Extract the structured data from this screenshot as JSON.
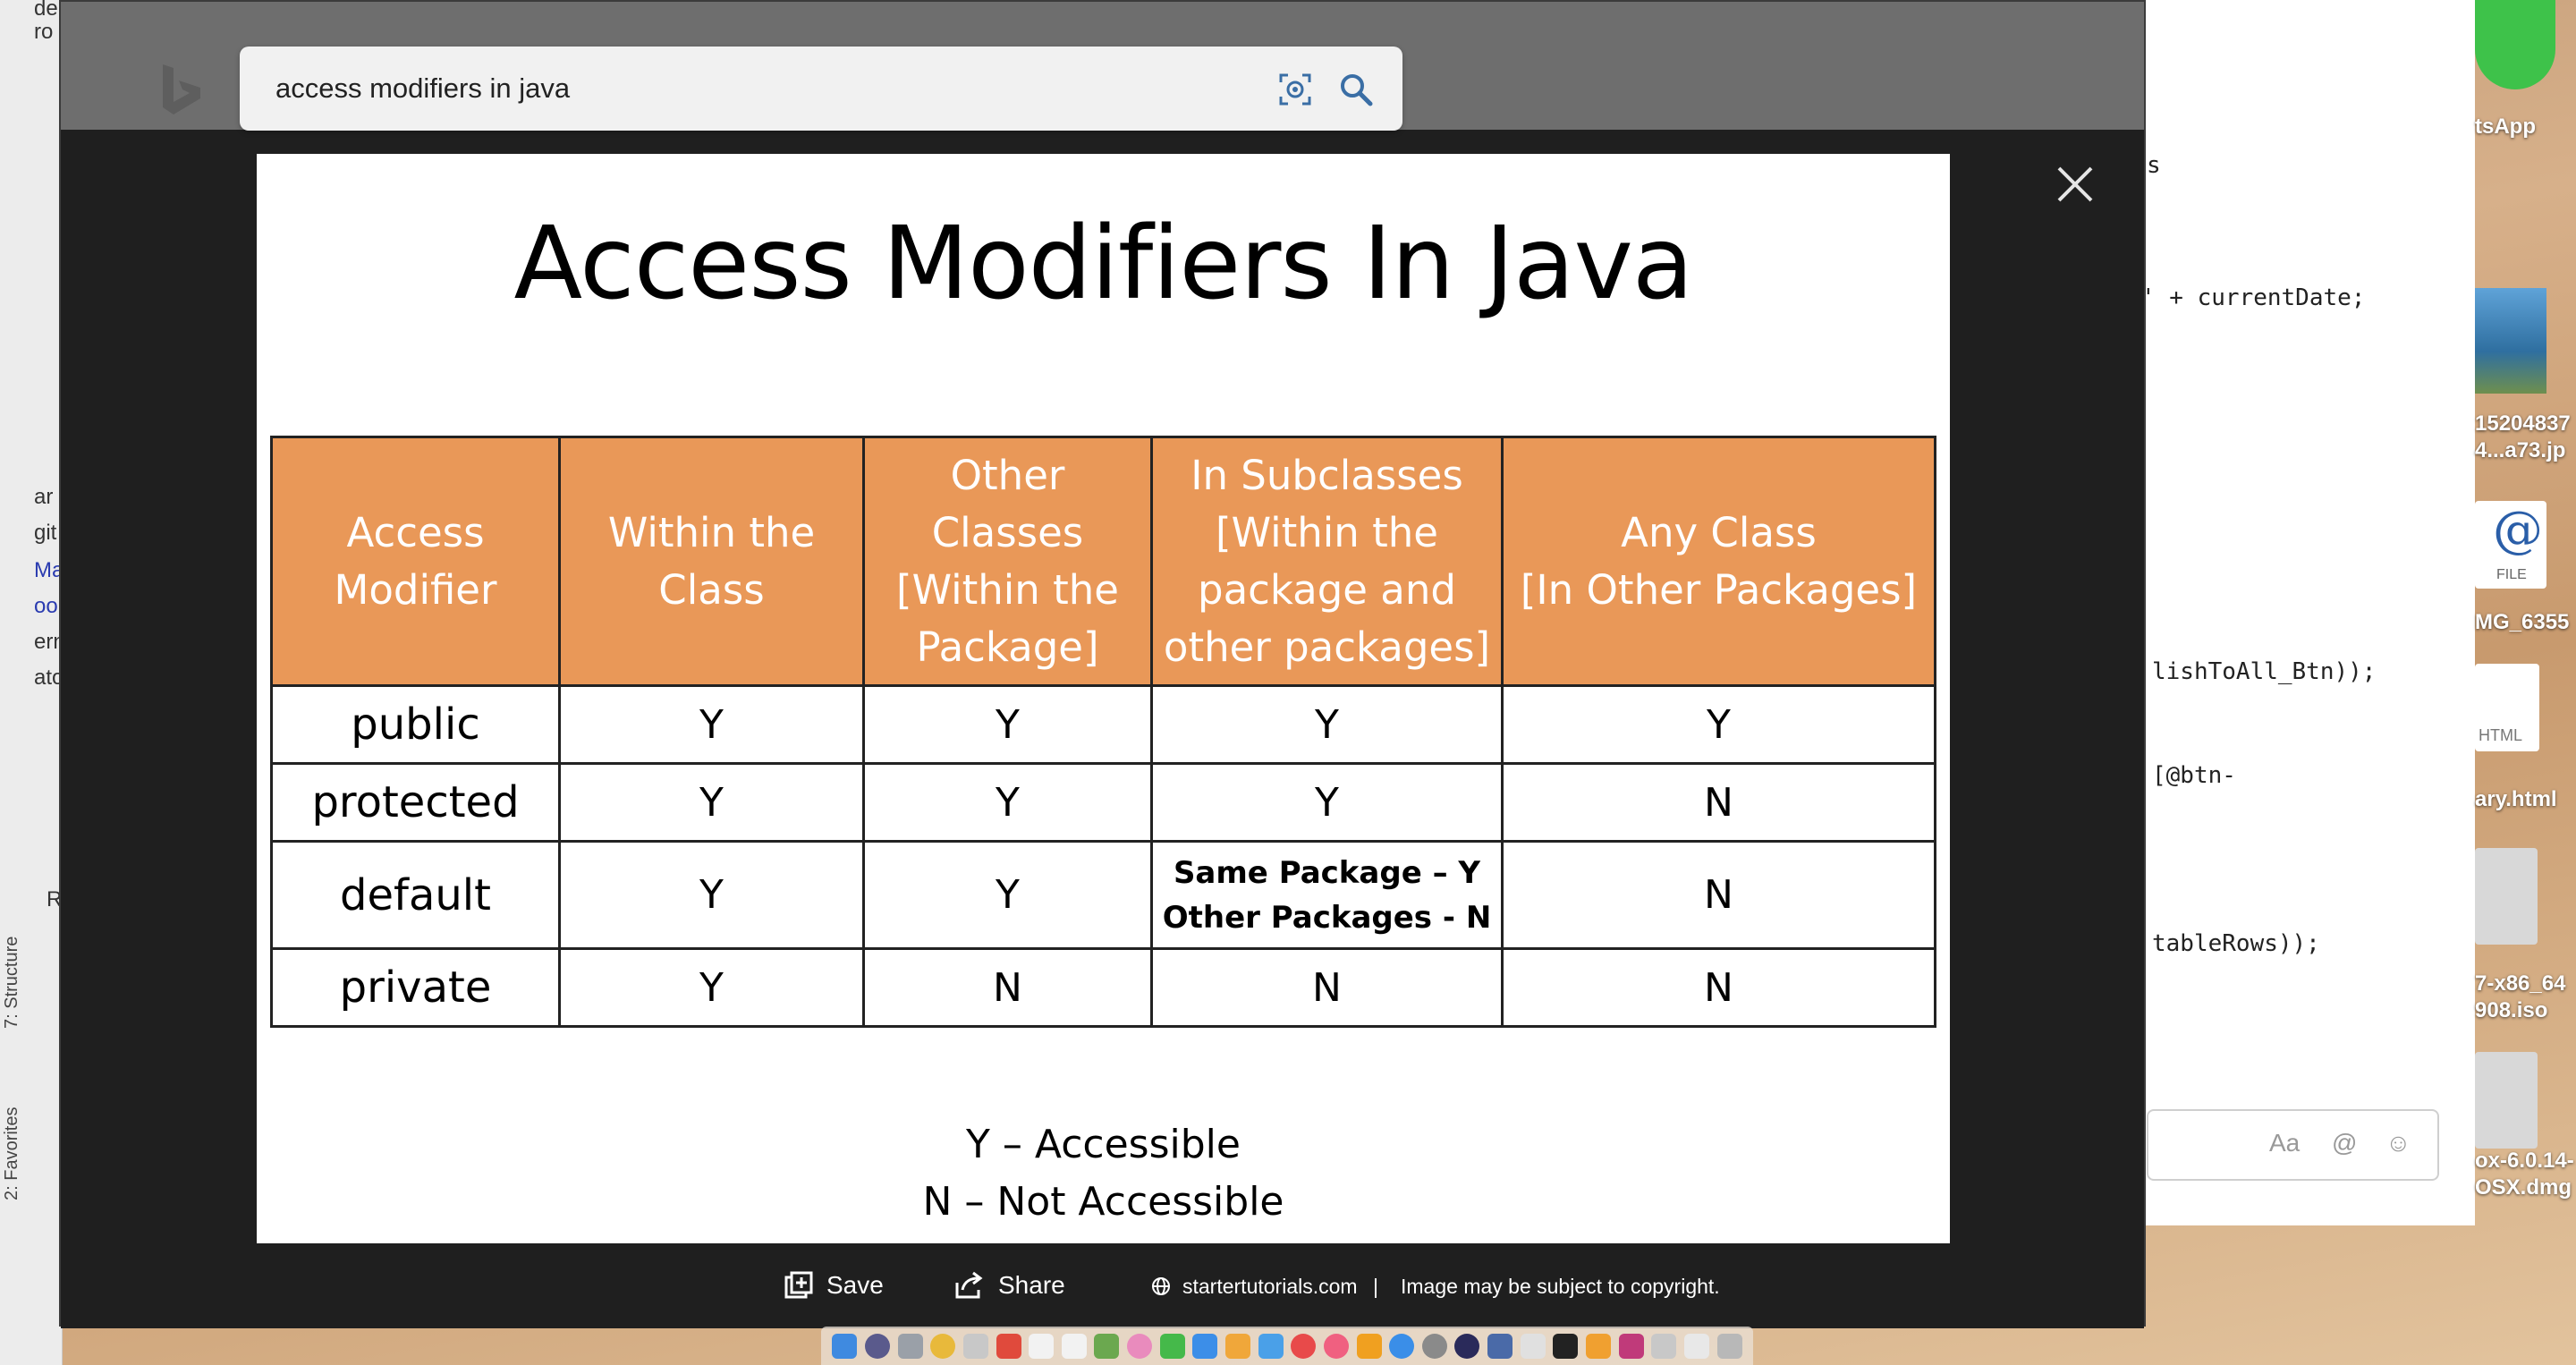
{
  "search": {
    "query": "access modifiers in java"
  },
  "slide": {
    "title": "Access Modifiers In Java",
    "table": {
      "headers": [
        [
          "Access",
          "Modifier"
        ],
        [
          "Within the",
          "Class"
        ],
        [
          "Other",
          "Classes",
          "[Within the",
          "Package]"
        ],
        [
          "In Subclasses",
          "[Within the",
          "package and",
          "other packages]"
        ],
        [
          "Any Class",
          "[In Other Packages]"
        ]
      ],
      "rows": [
        {
          "modifier": "public",
          "cells": [
            "Y",
            "Y",
            "Y",
            "Y"
          ]
        },
        {
          "modifier": "protected",
          "cells": [
            "Y",
            "Y",
            "Y",
            "N"
          ]
        },
        {
          "modifier": "default",
          "cells": [
            "Y",
            "Y",
            "Same Package – Y|Other Packages - N",
            "N"
          ]
        },
        {
          "modifier": "private",
          "cells": [
            "Y",
            "N",
            "N",
            "N"
          ]
        }
      ]
    },
    "legend": [
      "Y – Accessible",
      "N – Not Accessible"
    ]
  },
  "footer": {
    "save_label": "Save",
    "share_label": "Share",
    "source": "startertutorials.com",
    "separator": "|",
    "copyright": "Image may be subject to copyright."
  },
  "background": {
    "ide_fragments": [
      "de",
      "ro",
      "ar",
      "git",
      "Ma",
      "oo",
      "ern",
      "ato",
      "R"
    ],
    "ide_tabs": [
      "7: Structure",
      "2: Favorites"
    ],
    "code_lines": [
      "' + currentDate;",
      "lishToAll_Btn));",
      "[@btn-",
      "tableRows));",
      ".",
      "s"
    ],
    "chat_placeholder": "Aa",
    "desktop_icons": [
      "tsApp",
      "15204837",
      "4...a73.jp",
      "FILE",
      "MG_6355",
      "HTML",
      "ary.html",
      "7-x86_64",
      "908.iso",
      "ox-6.0.14-",
      "OSX.dmg"
    ]
  },
  "colors": {
    "header_orange": "#e99858",
    "viewer_bg": "#1f1f1f",
    "topbar": "#6e6e6e"
  }
}
